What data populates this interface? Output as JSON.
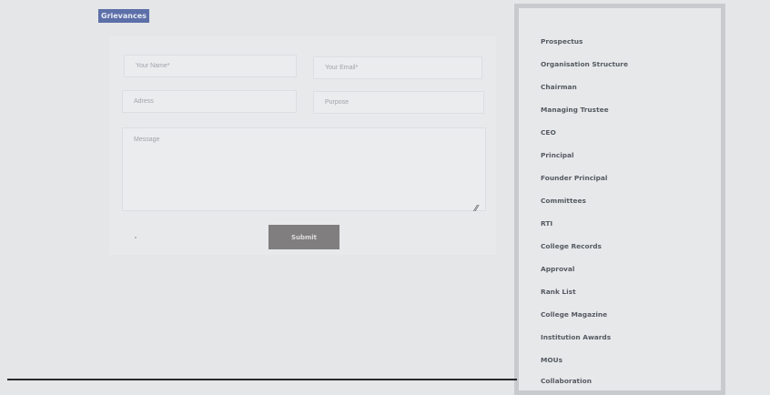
{
  "breadcrumb": {
    "label": "Grievances"
  },
  "form": {
    "name_placeholder": "Your Name*",
    "email_placeholder": "Your Email*",
    "address_placeholder": "Adress",
    "purpose_placeholder": "Purpose",
    "message_placeholder": "Message",
    "submit_label": "Submit"
  },
  "sidebar": {
    "items": [
      {
        "label": "Prospectus"
      },
      {
        "label": "Organisation Structure"
      },
      {
        "label": "Chairman"
      },
      {
        "label": "Managing Trustee"
      },
      {
        "label": "CEO"
      },
      {
        "label": "Principal"
      },
      {
        "label": "Founder Principal"
      },
      {
        "label": "Committees"
      },
      {
        "label": "RTI"
      },
      {
        "label": "College Records"
      },
      {
        "label": "Approval"
      },
      {
        "label": "Rank List"
      },
      {
        "label": "College Magazine"
      },
      {
        "label": "Institution Awards"
      },
      {
        "label": "MOUs"
      },
      {
        "label": "Collaboration"
      }
    ]
  }
}
